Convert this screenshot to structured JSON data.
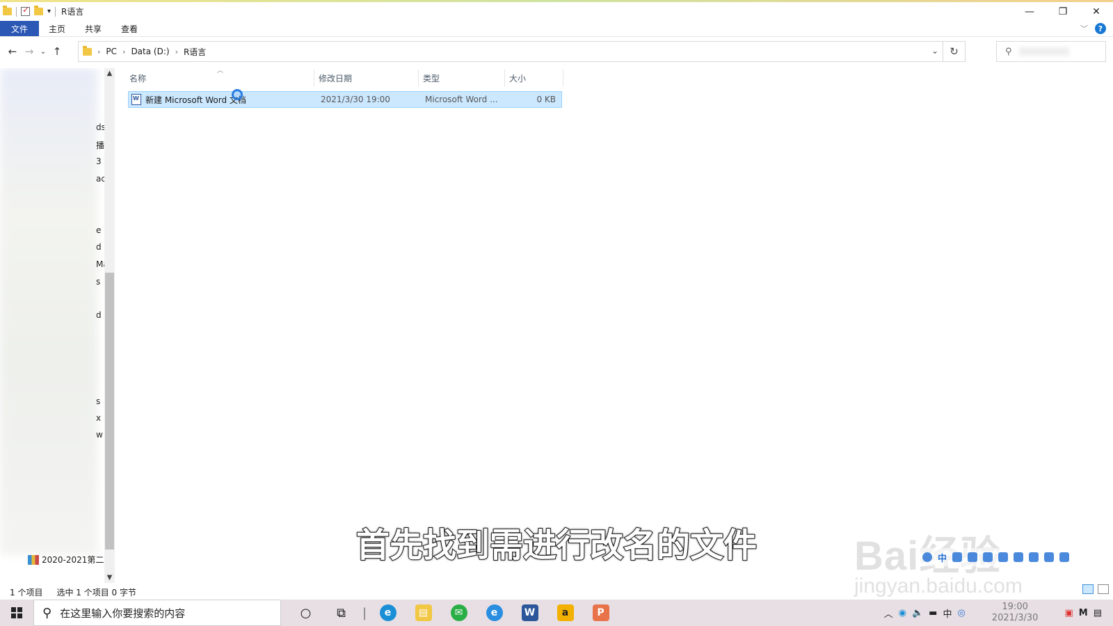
{
  "window": {
    "title": "R语言"
  },
  "ribbon": {
    "tabs": [
      "文件",
      "主页",
      "共享",
      "查看"
    ]
  },
  "address": {
    "crumbs": [
      "PC",
      "Data (D:)",
      "R语言"
    ]
  },
  "sidebar": {
    "peek_letters": [
      "ds",
      "播",
      "3",
      "ac",
      "e",
      "d",
      "Ma",
      "s",
      "d",
      "s",
      "x",
      "w"
    ],
    "bottom_item": "2020-2021第二"
  },
  "columns": [
    "名称",
    "修改日期",
    "类型",
    "大小"
  ],
  "files": [
    {
      "name": "新建 Microsoft Word 文档",
      "date": "2021/3/30 19:00",
      "type": "Microsoft Word ...",
      "size": "0 KB"
    }
  ],
  "status": {
    "count": "1 个项目",
    "selected": "选中 1 个项目  0 字节"
  },
  "overlay": {
    "caption": "首先找到需进行改名的文件",
    "watermark": "Bai经验",
    "watermark_url": "jingyan.baidu.com"
  },
  "taskbar": {
    "search_placeholder": "在这里输入你要搜索的内容",
    "time": "19:00",
    "date": "2021/3/30",
    "ime": "中"
  }
}
